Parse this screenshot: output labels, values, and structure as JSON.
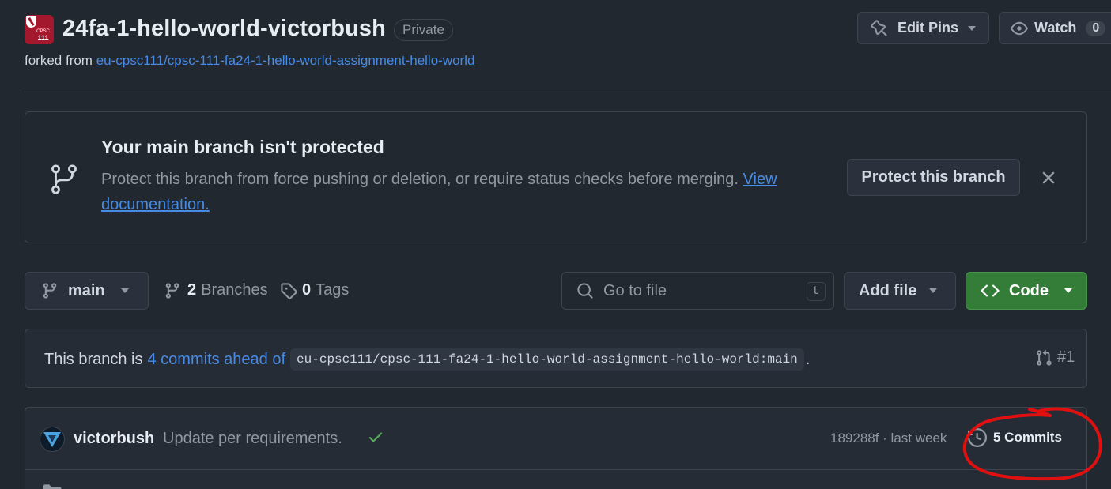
{
  "repo": {
    "avatar_text_top": "CPSC",
    "avatar_text_bottom": "111",
    "name": "24fa-1-hello-world-victorbush",
    "visibility": "Private",
    "forked_prefix": "forked from",
    "forked_link": "eu-cpsc111/cpsc-111-fa24-1-hello-world-assignment-hello-world"
  },
  "header_actions": {
    "edit_pins": "Edit Pins",
    "watch": "Watch",
    "watch_count": "0"
  },
  "banner": {
    "title": "Your main branch isn't protected",
    "text": "Protect this branch from force pushing or deletion, or require status checks before merging.",
    "link": "View documentation.",
    "button": "Protect this branch"
  },
  "toolbar": {
    "branch": "main",
    "branches_count": "2",
    "branches_label": "Branches",
    "tags_count": "0",
    "tags_label": "Tags",
    "search_placeholder": "Go to file",
    "search_shortcut": "t",
    "add_file": "Add file",
    "code": "Code"
  },
  "ahead": {
    "prefix": "This branch is",
    "link": "4 commits ahead of",
    "ref": "eu-cpsc111/cpsc-111-fa24-1-hello-world-assignment-hello-world:main",
    "suffix": ".",
    "pr": "#1"
  },
  "latest_commit": {
    "author": "victorbush",
    "message": "Update per requirements.",
    "meta": "189288f · last week",
    "commits": "5 Commits"
  },
  "colors": {
    "background": "#212830",
    "link": "#478be6",
    "code_button": "#347d39",
    "annotation": "#e01010"
  }
}
